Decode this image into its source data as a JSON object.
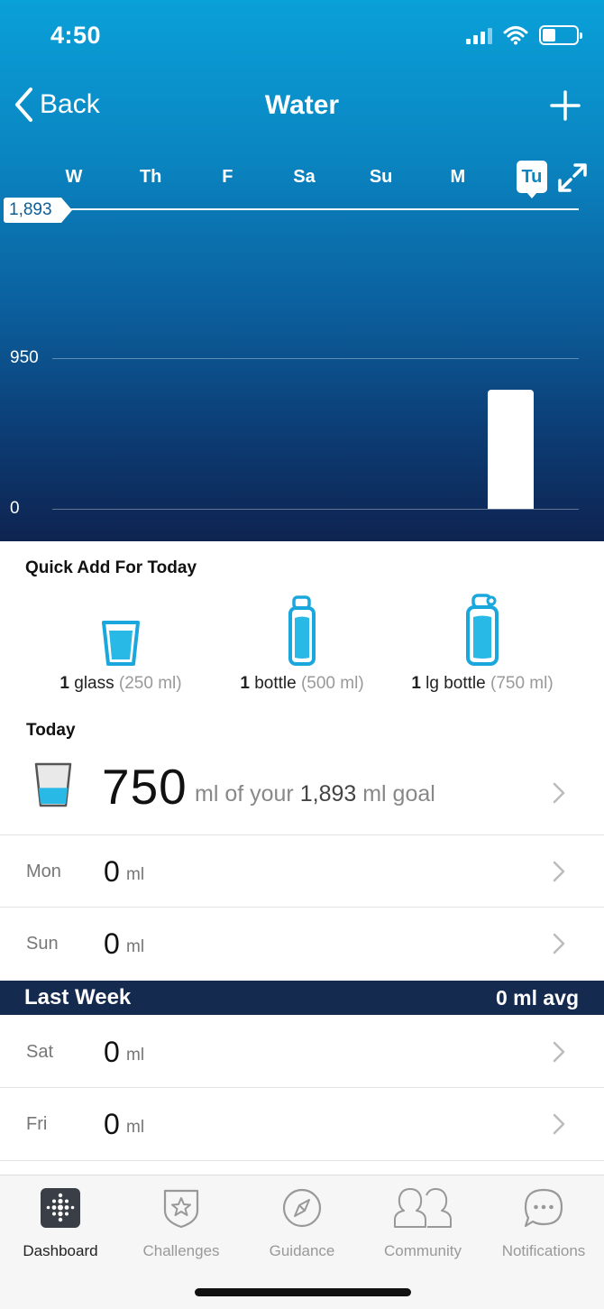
{
  "status": {
    "time": "4:50"
  },
  "nav": {
    "back_label": "Back",
    "title": "Water"
  },
  "week_days": [
    {
      "label": "W",
      "selected": false
    },
    {
      "label": "Th",
      "selected": false
    },
    {
      "label": "F",
      "selected": false
    },
    {
      "label": "Sa",
      "selected": false
    },
    {
      "label": "Su",
      "selected": false
    },
    {
      "label": "M",
      "selected": false
    },
    {
      "label": "Tu",
      "selected": true
    }
  ],
  "chart_data": {
    "type": "bar",
    "categories": [
      "W",
      "Th",
      "F",
      "Sa",
      "Su",
      "M",
      "Tu"
    ],
    "values": [
      0,
      0,
      0,
      0,
      0,
      0,
      750
    ],
    "goal": 1893,
    "goal_label": "1,893",
    "yticks": [
      "950",
      "0"
    ],
    "ylim": [
      0,
      1893
    ],
    "grid": true
  },
  "quick_add": {
    "title": "Quick Add For Today",
    "items": [
      {
        "qty": "1",
        "name": "glass",
        "amount": "(250 ml)",
        "icon": "glass-icon"
      },
      {
        "qty": "1",
        "name": "bottle",
        "amount": "(500 ml)",
        "icon": "bottle-icon"
      },
      {
        "qty": "1",
        "name": "lg bottle",
        "amount": "(750 ml)",
        "icon": "large-bottle-icon"
      }
    ]
  },
  "today": {
    "title": "Today",
    "amount": "750",
    "text_pre": "ml of your",
    "goal": "1,893",
    "text_post": "ml goal",
    "fill_fraction": 0.4
  },
  "recent_days": [
    {
      "day": "Mon",
      "value": "0",
      "unit": "ml"
    },
    {
      "day": "Sun",
      "value": "0",
      "unit": "ml"
    }
  ],
  "last_week": {
    "title": "Last Week",
    "avg": "0 ml avg",
    "days": [
      {
        "day": "Sat",
        "value": "0",
        "unit": "ml"
      },
      {
        "day": "Fri",
        "value": "0",
        "unit": "ml"
      }
    ]
  },
  "tabs": [
    {
      "label": "Dashboard",
      "icon": "dashboard-icon",
      "active": true
    },
    {
      "label": "Challenges",
      "icon": "challenges-icon",
      "active": false
    },
    {
      "label": "Guidance",
      "icon": "compass-icon",
      "active": false
    },
    {
      "label": "Community",
      "icon": "community-icon",
      "active": false
    },
    {
      "label": "Notifications",
      "icon": "notifications-icon",
      "active": false
    }
  ],
  "colors": {
    "accent": "#0aa0d8",
    "water": "#29b9e6",
    "navy": "#152a4f"
  }
}
